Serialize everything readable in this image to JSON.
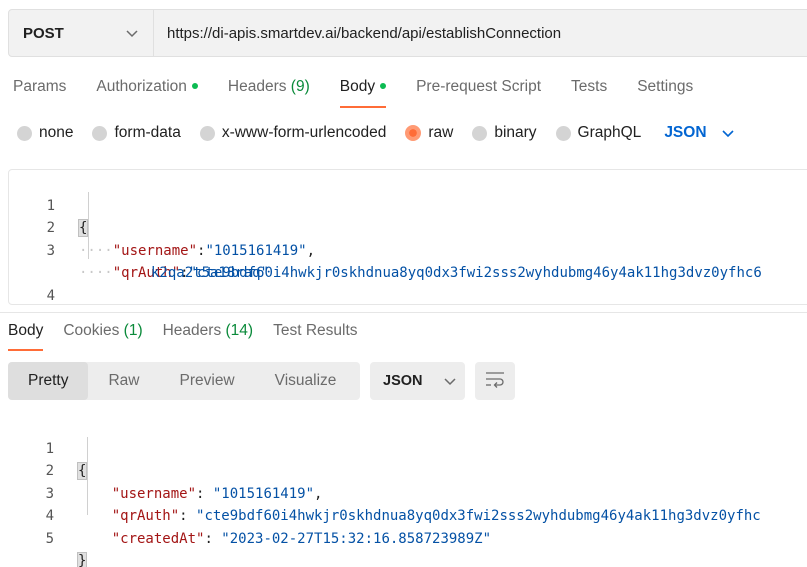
{
  "request": {
    "method": "POST",
    "url": "https://di-apis.smartdev.ai/backend/api/establishConnection"
  },
  "tabs": [
    {
      "label": "Params"
    },
    {
      "label": "Authorization"
    },
    {
      "label": "Headers",
      "count": "(9)"
    },
    {
      "label": "Body"
    },
    {
      "label": "Pre-request Script"
    },
    {
      "label": "Tests"
    },
    {
      "label": "Settings"
    }
  ],
  "body_types": {
    "options": [
      "none",
      "form-data",
      "x-www-form-urlencoded",
      "raw",
      "binary",
      "GraphQL"
    ],
    "selected": "raw",
    "format": "JSON"
  },
  "request_body": {
    "line_numbers": [
      "1",
      "2",
      "3",
      "4"
    ],
    "open": "{",
    "close": "}",
    "username_key": "\"username\"",
    "username_val": "\"1015161419\"",
    "qrauth_key": "\"qrAuth\"",
    "qrauth_val_1": "\"cte9bdf60i4hwkjr0skhdnua8yq0dx3fwi2sss2wyhdubmg46y4ak11hg3dvz0yfhc6",
    "qrauth_val_2": "k2qa2t5a18raq\""
  },
  "response_tabs": [
    {
      "label": "Body"
    },
    {
      "label": "Cookies",
      "count": "(1)"
    },
    {
      "label": "Headers",
      "count": "(14)"
    },
    {
      "label": "Test Results"
    }
  ],
  "view_modes": [
    "Pretty",
    "Raw",
    "Preview",
    "Visualize"
  ],
  "response_format": "JSON",
  "response_body": {
    "line_numbers": [
      "1",
      "2",
      "3",
      "4",
      "5"
    ],
    "open": "{",
    "close": "}",
    "username_key": "\"username\"",
    "username_val": "\"1015161419\"",
    "qrauth_key": "\"qrAuth\"",
    "qrauth_val": "\"cte9bdf60i4hwkjr0skhdnua8yq0dx3fwi2sss2wyhdubmg46y4ak11hg3dvz0yfhc",
    "created_key": "\"createdAt\"",
    "created_val": "\"2023-02-27T15:32:16.858723989Z\""
  },
  "colors": {
    "accent": "#ff6c37",
    "status_dot": "#0cbb52",
    "link_blue": "#0265d2",
    "json_key": "#a31515",
    "json_string": "#0451a5"
  }
}
